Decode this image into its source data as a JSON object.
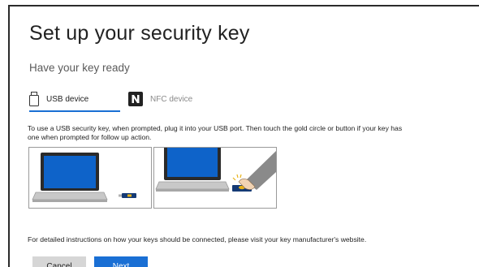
{
  "dialog": {
    "title": "Set up your security key",
    "subtitle": "Have your key ready",
    "tabs": [
      {
        "label": "USB device",
        "icon": "usb-key-icon",
        "selected": true
      },
      {
        "label": "NFC device",
        "icon": "nfc-icon",
        "selected": false
      }
    ],
    "description_lines": [
      "To use a USB security key, when prompted, plug it into your USB port. Then touch the gold circle or button if your key has",
      "one when prompted for follow up action."
    ],
    "illustrations": [
      {
        "icon": "laptop-with-usb-key-icon"
      },
      {
        "icon": "finger-touching-key-icon"
      }
    ],
    "footer_text": "For detailed instructions on how your keys should be connected, please visit your key manufacturer's website.",
    "buttons": {
      "cancel": "Cancel",
      "next": "Next"
    }
  },
  "colors": {
    "accent": "#1a6fd4",
    "screen": "#0e63c9",
    "key": "#153a75",
    "key_gold": "#e8b318",
    "laptop_base": "#c8c8c8"
  }
}
